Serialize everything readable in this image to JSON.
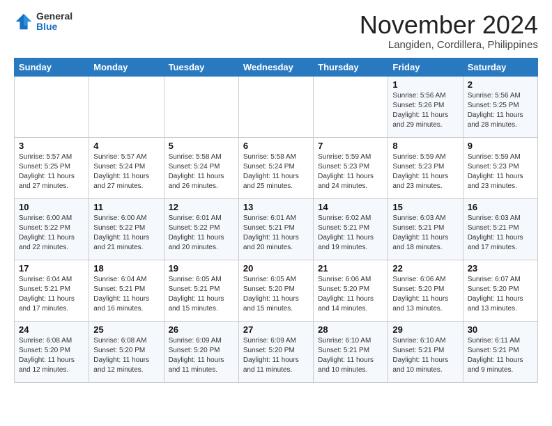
{
  "header": {
    "logo_general": "General",
    "logo_blue": "Blue",
    "month_title": "November 2024",
    "location": "Langiden, Cordillera, Philippines"
  },
  "weekdays": [
    "Sunday",
    "Monday",
    "Tuesday",
    "Wednesday",
    "Thursday",
    "Friday",
    "Saturday"
  ],
  "weeks": [
    [
      {
        "day": "",
        "info": ""
      },
      {
        "day": "",
        "info": ""
      },
      {
        "day": "",
        "info": ""
      },
      {
        "day": "",
        "info": ""
      },
      {
        "day": "",
        "info": ""
      },
      {
        "day": "1",
        "info": "Sunrise: 5:56 AM\nSunset: 5:26 PM\nDaylight: 11 hours\nand 29 minutes."
      },
      {
        "day": "2",
        "info": "Sunrise: 5:56 AM\nSunset: 5:25 PM\nDaylight: 11 hours\nand 28 minutes."
      }
    ],
    [
      {
        "day": "3",
        "info": "Sunrise: 5:57 AM\nSunset: 5:25 PM\nDaylight: 11 hours\nand 27 minutes."
      },
      {
        "day": "4",
        "info": "Sunrise: 5:57 AM\nSunset: 5:24 PM\nDaylight: 11 hours\nand 27 minutes."
      },
      {
        "day": "5",
        "info": "Sunrise: 5:58 AM\nSunset: 5:24 PM\nDaylight: 11 hours\nand 26 minutes."
      },
      {
        "day": "6",
        "info": "Sunrise: 5:58 AM\nSunset: 5:24 PM\nDaylight: 11 hours\nand 25 minutes."
      },
      {
        "day": "7",
        "info": "Sunrise: 5:59 AM\nSunset: 5:23 PM\nDaylight: 11 hours\nand 24 minutes."
      },
      {
        "day": "8",
        "info": "Sunrise: 5:59 AM\nSunset: 5:23 PM\nDaylight: 11 hours\nand 23 minutes."
      },
      {
        "day": "9",
        "info": "Sunrise: 5:59 AM\nSunset: 5:23 PM\nDaylight: 11 hours\nand 23 minutes."
      }
    ],
    [
      {
        "day": "10",
        "info": "Sunrise: 6:00 AM\nSunset: 5:22 PM\nDaylight: 11 hours\nand 22 minutes."
      },
      {
        "day": "11",
        "info": "Sunrise: 6:00 AM\nSunset: 5:22 PM\nDaylight: 11 hours\nand 21 minutes."
      },
      {
        "day": "12",
        "info": "Sunrise: 6:01 AM\nSunset: 5:22 PM\nDaylight: 11 hours\nand 20 minutes."
      },
      {
        "day": "13",
        "info": "Sunrise: 6:01 AM\nSunset: 5:21 PM\nDaylight: 11 hours\nand 20 minutes."
      },
      {
        "day": "14",
        "info": "Sunrise: 6:02 AM\nSunset: 5:21 PM\nDaylight: 11 hours\nand 19 minutes."
      },
      {
        "day": "15",
        "info": "Sunrise: 6:03 AM\nSunset: 5:21 PM\nDaylight: 11 hours\nand 18 minutes."
      },
      {
        "day": "16",
        "info": "Sunrise: 6:03 AM\nSunset: 5:21 PM\nDaylight: 11 hours\nand 17 minutes."
      }
    ],
    [
      {
        "day": "17",
        "info": "Sunrise: 6:04 AM\nSunset: 5:21 PM\nDaylight: 11 hours\nand 17 minutes."
      },
      {
        "day": "18",
        "info": "Sunrise: 6:04 AM\nSunset: 5:21 PM\nDaylight: 11 hours\nand 16 minutes."
      },
      {
        "day": "19",
        "info": "Sunrise: 6:05 AM\nSunset: 5:21 PM\nDaylight: 11 hours\nand 15 minutes."
      },
      {
        "day": "20",
        "info": "Sunrise: 6:05 AM\nSunset: 5:20 PM\nDaylight: 11 hours\nand 15 minutes."
      },
      {
        "day": "21",
        "info": "Sunrise: 6:06 AM\nSunset: 5:20 PM\nDaylight: 11 hours\nand 14 minutes."
      },
      {
        "day": "22",
        "info": "Sunrise: 6:06 AM\nSunset: 5:20 PM\nDaylight: 11 hours\nand 13 minutes."
      },
      {
        "day": "23",
        "info": "Sunrise: 6:07 AM\nSunset: 5:20 PM\nDaylight: 11 hours\nand 13 minutes."
      }
    ],
    [
      {
        "day": "24",
        "info": "Sunrise: 6:08 AM\nSunset: 5:20 PM\nDaylight: 11 hours\nand 12 minutes."
      },
      {
        "day": "25",
        "info": "Sunrise: 6:08 AM\nSunset: 5:20 PM\nDaylight: 11 hours\nand 12 minutes."
      },
      {
        "day": "26",
        "info": "Sunrise: 6:09 AM\nSunset: 5:20 PM\nDaylight: 11 hours\nand 11 minutes."
      },
      {
        "day": "27",
        "info": "Sunrise: 6:09 AM\nSunset: 5:20 PM\nDaylight: 11 hours\nand 11 minutes."
      },
      {
        "day": "28",
        "info": "Sunrise: 6:10 AM\nSunset: 5:21 PM\nDaylight: 11 hours\nand 10 minutes."
      },
      {
        "day": "29",
        "info": "Sunrise: 6:10 AM\nSunset: 5:21 PM\nDaylight: 11 hours\nand 10 minutes."
      },
      {
        "day": "30",
        "info": "Sunrise: 6:11 AM\nSunset: 5:21 PM\nDaylight: 11 hours\nand 9 minutes."
      }
    ]
  ]
}
